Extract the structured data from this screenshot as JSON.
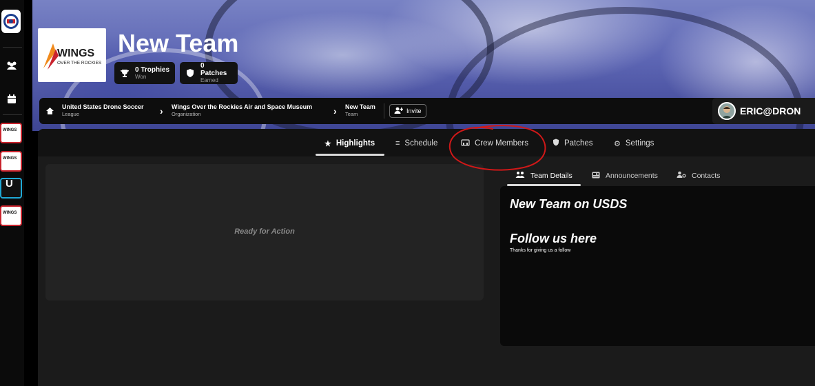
{
  "rail": {
    "icons": [
      "users-icon",
      "calendar-icon"
    ],
    "tiles": [
      {
        "label": "WINGS",
        "active": false
      },
      {
        "label": "WINGS",
        "active": false
      },
      {
        "label": "U",
        "active": true
      },
      {
        "label": "WINGS",
        "active": false
      }
    ]
  },
  "header": {
    "logo": {
      "brand": "WINGS",
      "tagline": "OVER THE ROCKIES"
    },
    "team_name": "New Team",
    "stats": [
      {
        "icon": "trophy-icon",
        "value": "0 Trophies",
        "caption": "Won"
      },
      {
        "icon": "shield-icon",
        "value": "0 Patches",
        "caption": "Earned"
      }
    ]
  },
  "breadcrumb": [
    {
      "title": "United States Drone Soccer",
      "subtitle": "League"
    },
    {
      "title": "Wings Over the Rockies Air and Space Museum",
      "subtitle": "Organization"
    },
    {
      "title": "New Team",
      "subtitle": "Team"
    }
  ],
  "invite_label": "Invite",
  "user": {
    "name": "ERIC@DRON"
  },
  "tabs": [
    {
      "label": "Highlights",
      "icon": "star-icon",
      "active": true
    },
    {
      "label": "Schedule",
      "icon": "list-icon",
      "active": false
    },
    {
      "label": "Crew Members",
      "icon": "crew-icon",
      "active": false
    },
    {
      "label": "Patches",
      "icon": "shield-icon",
      "active": false
    },
    {
      "label": "Settings",
      "icon": "gear-icon",
      "active": false
    }
  ],
  "highlights": {
    "placeholder": "Ready for Action"
  },
  "subtabs": [
    {
      "label": "Team Details",
      "icon": "team-icon",
      "active": true
    },
    {
      "label": "Announcements",
      "icon": "newspaper-icon",
      "active": false
    },
    {
      "label": "Contacts",
      "icon": "contacts-icon",
      "active": false
    }
  ],
  "details": {
    "heading": "New Team on USDS",
    "follow_heading": "Follow us here",
    "follow_text": "Thanks for giving us a follow"
  },
  "annotation": {
    "color": "#d01818"
  }
}
